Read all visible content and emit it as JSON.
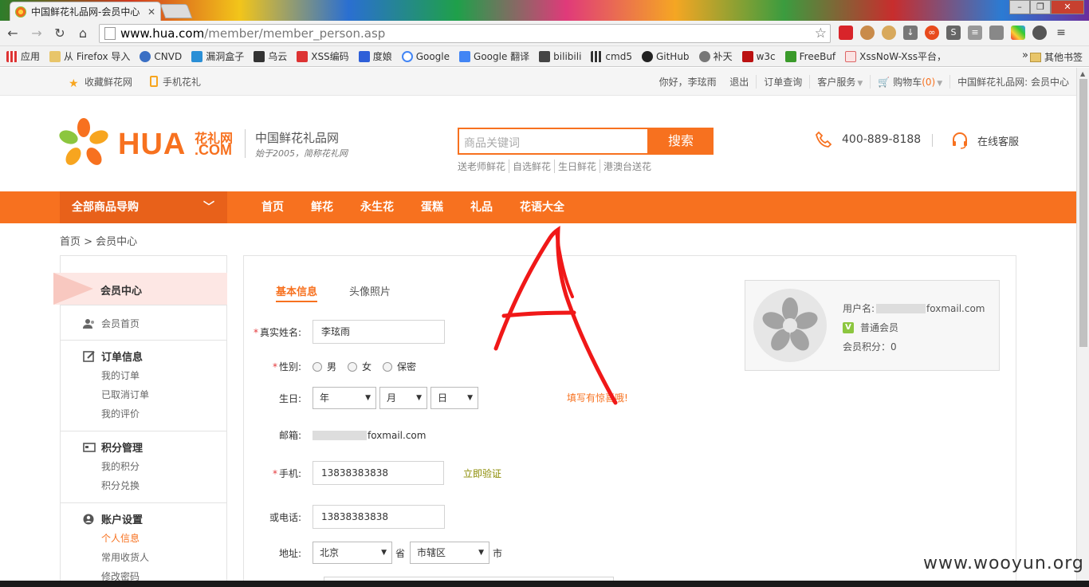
{
  "browser": {
    "tab_title": "中国鲜花礼品网-会员中心",
    "tab_close": "✕",
    "url_host": "www.hua.com",
    "url_path": "/member/member_person.asp",
    "bookmarks": [
      "应用",
      "从 Firefox 导入",
      "CNVD",
      "漏洞盒子",
      "乌云",
      "XSS编码",
      "度娘",
      "Google",
      "Google 翻译",
      "bilibili",
      "cmd5",
      "GitHub",
      "补天",
      "w3c",
      "FreeBuf",
      "XssNoW-Xss平台，"
    ],
    "bookmarks_more": "»",
    "other_bookmarks": "其他书签"
  },
  "topbar": {
    "favorite": "收藏鲜花网",
    "mobile": "手机花礼",
    "greeting": "你好，李玹雨",
    "logout": "退出",
    "order_query": "订单查询",
    "customer_service": "客户服务",
    "cart_label": "购物车",
    "cart_count": "(0)",
    "site_name": "中国鲜花礼品网: 会员中心"
  },
  "header": {
    "logo_text": "HUA",
    "logo_cn": "花礼网",
    "logo_com": ".COM",
    "slogan": "中国鲜花礼品网",
    "slogan_sub": "始于2005，简称花礼网",
    "search_placeholder": "商品关键词",
    "search_button": "搜索",
    "hot_words": [
      "送老师鲜花",
      "自选鲜花",
      "生日鲜花",
      "港澳台送花"
    ],
    "phone": "400-889-8188",
    "online_service": "在线客服"
  },
  "nav": {
    "all_categories": "全部商品导购",
    "links": [
      "首页",
      "鲜花",
      "永生花",
      "蛋糕",
      "礼品",
      "花语大全"
    ]
  },
  "breadcrumb": "首页 > 会员中心",
  "sidebar": {
    "head": "会员中心",
    "member_home": "会员首页",
    "orders_title": "订单信息",
    "orders_items": [
      "我的订单",
      "已取消订单",
      "我的评价"
    ],
    "points_title": "积分管理",
    "points_items": [
      "我的积分",
      "积分兑换"
    ],
    "account_title": "账户设置",
    "account_items": [
      "个人信息",
      "常用收货人",
      "修改密码"
    ]
  },
  "form": {
    "tab_basic": "基本信息",
    "tab_avatar": "头像照片",
    "req_mark": "*",
    "name_label": "真实姓名:",
    "name_value": "李玹雨",
    "gender_label": "性别:",
    "gender_options": [
      "男",
      "女",
      "保密"
    ],
    "birthday_label": "生日:",
    "year": "年",
    "month": "月",
    "day": "日",
    "birthday_hint": "填写有惊喜哦!",
    "email_label": "邮箱:",
    "email_suffix": "foxmail.com",
    "mobile_label": "手机:",
    "mobile_value": "13838383838",
    "verify_now": "立即验证",
    "phone_label": "或电话:",
    "phone_value": "13838383838",
    "address_label": "地址:",
    "province": "北京",
    "province_unit": "省",
    "city": "市辖区",
    "city_unit": "市"
  },
  "userbox": {
    "username_label": "用户名:",
    "username_suffix": "foxmail.com",
    "level": "普通会员",
    "level_badge": "V",
    "points_label": "会员积分：0"
  },
  "watermark": "www.wooyun.org",
  "colors": {
    "accent": "#f7711f",
    "accent_dark": "#e8611a",
    "green": "#8cc63f"
  }
}
